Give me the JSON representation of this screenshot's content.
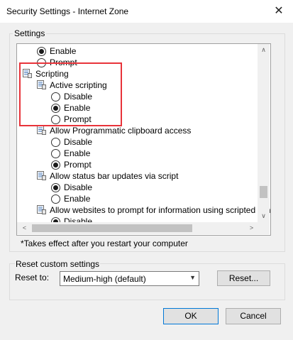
{
  "window": {
    "title": "Security Settings - Internet Zone",
    "close_glyph": "✕"
  },
  "settings_group": {
    "label": "Settings",
    "list": {
      "rows": [
        {
          "kind": "radio",
          "text": "Enable",
          "checked": true,
          "indent": 1
        },
        {
          "kind": "radio",
          "text": "Prompt",
          "checked": false,
          "indent": 1
        },
        {
          "kind": "group",
          "text": "Scripting",
          "indent": 0
        },
        {
          "kind": "group",
          "text": "Active scripting",
          "indent": 1
        },
        {
          "kind": "radio",
          "text": "Disable",
          "checked": false,
          "indent": 2
        },
        {
          "kind": "radio",
          "text": "Enable",
          "checked": true,
          "indent": 2
        },
        {
          "kind": "radio",
          "text": "Prompt",
          "checked": false,
          "indent": 2
        },
        {
          "kind": "group",
          "text": "Allow Programmatic clipboard access",
          "indent": 1
        },
        {
          "kind": "radio",
          "text": "Disable",
          "checked": false,
          "indent": 2
        },
        {
          "kind": "radio",
          "text": "Enable",
          "checked": false,
          "indent": 2
        },
        {
          "kind": "radio",
          "text": "Prompt",
          "checked": true,
          "indent": 2
        },
        {
          "kind": "group",
          "text": "Allow status bar updates via script",
          "indent": 1
        },
        {
          "kind": "radio",
          "text": "Disable",
          "checked": true,
          "indent": 2
        },
        {
          "kind": "radio",
          "text": "Enable",
          "checked": false,
          "indent": 2
        },
        {
          "kind": "group",
          "text": "Allow websites to prompt for information using scripted windo",
          "indent": 1
        },
        {
          "kind": "radio",
          "text": "Disable",
          "checked": true,
          "indent": 2
        }
      ]
    },
    "scroll_glyphs": {
      "up": "∧",
      "down": "∨",
      "left": "<",
      "right": ">"
    },
    "restart_note": "*Takes effect after you restart your computer"
  },
  "custom_group": {
    "label": "Reset custom settings",
    "reset_to_label": "Reset to:",
    "reset_to_value": "Medium-high (default)",
    "reset_button": "Reset..."
  },
  "footer": {
    "ok": "OK",
    "cancel": "Cancel"
  }
}
